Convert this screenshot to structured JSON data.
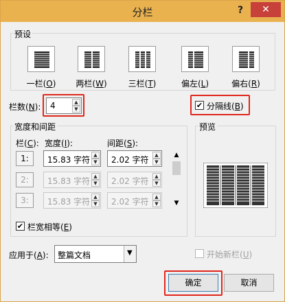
{
  "window": {
    "title": "分栏",
    "help": "?",
    "close": "✕"
  },
  "presets": {
    "group_label": "预设",
    "items": [
      {
        "label_pre": "一栏(",
        "key": "O",
        "label_post": ")"
      },
      {
        "label_pre": "两栏(",
        "key": "W",
        "label_post": ")"
      },
      {
        "label_pre": "三栏(",
        "key": "T",
        "label_post": ")"
      },
      {
        "label_pre": "偏左(",
        "key": "L",
        "label_post": ")"
      },
      {
        "label_pre": "偏右(",
        "key": "R",
        "label_post": ")"
      }
    ]
  },
  "num_columns": {
    "label_pre": "栏数(",
    "key": "N",
    "label_post": "):",
    "value": "4"
  },
  "divider": {
    "label_pre": "分隔线(",
    "key": "B",
    "label_post": ")",
    "checked": "✔"
  },
  "width_spacing": {
    "group_label": "宽度和间距",
    "col_header": {
      "pre": "栏(",
      "key": "C",
      "post": "):"
    },
    "width_header": {
      "pre": "宽度(",
      "key": "I",
      "post": "):"
    },
    "spacing_header": {
      "pre": "间距(",
      "key": "S",
      "post": "):"
    },
    "rows": [
      {
        "num": "1:",
        "width": "15.83 字符",
        "spacing": "2.02 字符"
      },
      {
        "num": "2:",
        "width": "15.83 字符",
        "spacing": "2.02 字符"
      },
      {
        "num": "3:",
        "width": "15.83 字符",
        "spacing": "2.02 字符"
      }
    ],
    "equal_width": {
      "label_pre": "栏宽相等(",
      "key": "E",
      "label_post": ")",
      "checked": "✔"
    }
  },
  "preview": {
    "label": "预览"
  },
  "apply_to": {
    "label_pre": "应用于(",
    "key": "A",
    "label_post": "):",
    "value": "整篇文档"
  },
  "new_column": {
    "label_pre": "开始新栏(",
    "key": "U",
    "label_post": ")"
  },
  "buttons": {
    "ok": "确定",
    "cancel_pre": "取消"
  }
}
